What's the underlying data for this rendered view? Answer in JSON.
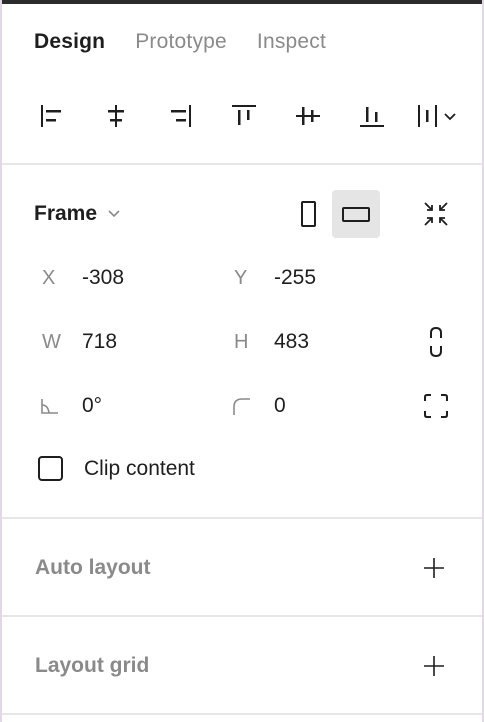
{
  "tabs": [
    {
      "label": "Design",
      "active": true
    },
    {
      "label": "Prototype",
      "active": false
    },
    {
      "label": "Inspect",
      "active": false
    }
  ],
  "alignment_toolbar": {
    "icons": [
      "align-left-icon",
      "align-horizontal-center-icon",
      "align-right-icon",
      "align-top-icon",
      "align-vertical-center-icon",
      "align-bottom-icon",
      "distribute-dropdown-icon"
    ]
  },
  "frame": {
    "title": "Frame",
    "orientation_selected": "landscape",
    "x": {
      "label": "X",
      "value": "-308"
    },
    "y": {
      "label": "Y",
      "value": "-255"
    },
    "w": {
      "label": "W",
      "value": "718"
    },
    "h": {
      "label": "H",
      "value": "483"
    },
    "rotation": {
      "value": "0°"
    },
    "corner_radius": {
      "value": "0"
    },
    "clip_content": {
      "label": "Clip content",
      "checked": false
    }
  },
  "sections": {
    "auto_layout": {
      "title": "Auto layout"
    },
    "layout_grid": {
      "title": "Layout grid"
    }
  },
  "colors": {
    "text_primary": "#1e1e1e",
    "text_secondary": "#8a8a8a",
    "divider": "#e6e6e6",
    "selected_bg": "#e5e5e5"
  }
}
